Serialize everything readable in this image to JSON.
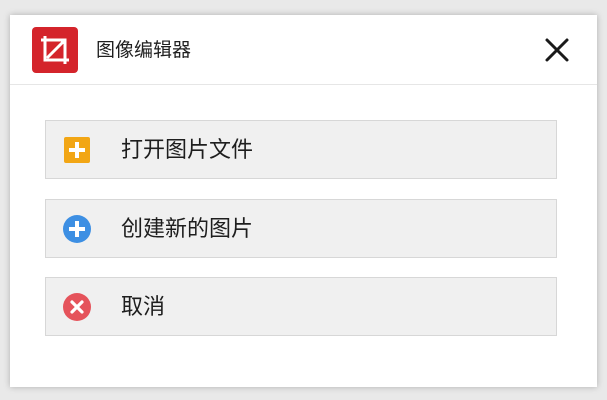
{
  "window": {
    "title": "图像编辑器",
    "app_icon": "red-crop-frame-icon",
    "close_icon": "close-x-icon"
  },
  "actions": [
    {
      "label": "打开图片文件",
      "icon": "plus-square-icon",
      "icon_color": "#f2a615"
    },
    {
      "label": "创建新的图片",
      "icon": "plus-circle-icon",
      "icon_color": "#3d8fe3"
    },
    {
      "label": "取消",
      "icon": "x-circle-icon",
      "icon_color": "#e5535b"
    }
  ],
  "colors": {
    "app_icon_bg": "#d4242b",
    "button_bg": "#f0f0f0",
    "button_border": "#d7d7d7"
  }
}
